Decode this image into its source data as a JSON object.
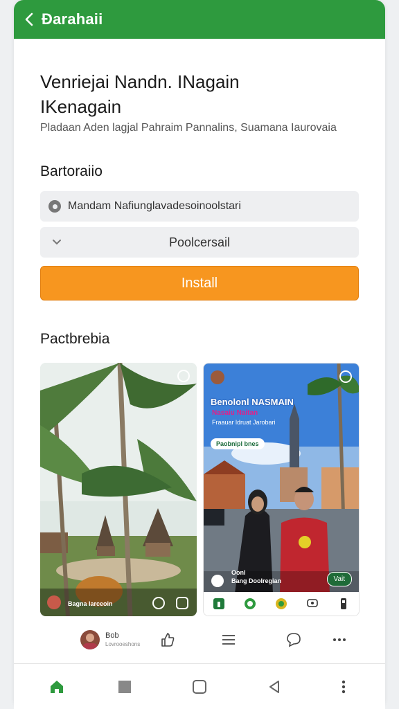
{
  "appbar": {
    "title": "Đarahaii",
    "background": "#2e9a3e"
  },
  "app": {
    "name_line1": "Venriejai Nandn. INagain",
    "name_line2": "IKenagain",
    "subtitle": "Pladaan Aden lagjal Pahraim Pannalins, Suamana Iaurovaia"
  },
  "section_install": {
    "label": "Bartoraiio",
    "url_text": "Mandam Nafiunglavadesoinoolstari",
    "select_value": "Poolcersail",
    "install_label": "Install",
    "install_color": "#f7961f"
  },
  "section_preview": {
    "label": "Pactbrebia",
    "shot1": {
      "caption": "Bagna   Iarceoin",
      "icons": [
        "notification-icon",
        "search-icon",
        "share-icon"
      ]
    },
    "shot2": {
      "poster_title": "Benolonl NASMAIN",
      "poster_sub": "Nasaiu Naitan",
      "poster_sub2": "Fraauar ldruat Jarobari",
      "poster_pill": "Paobnipl bnes",
      "caption_line1": "Oonl",
      "caption_line2": "Bang Doolregian",
      "visit_label": "Vait",
      "bottom_icons": [
        "calendar-icon",
        "globe-icon",
        "badge-icon",
        "chat-icon",
        "phone-icon"
      ]
    }
  },
  "action_row": {
    "user_name": "Bob",
    "user_sub": "Lovrooeshons",
    "icons": [
      "like-icon",
      "menu-icon",
      "comment-icon",
      "more-icon"
    ]
  },
  "navbar": {
    "icons": [
      "home-icon",
      "stop-icon",
      "square-icon",
      "back-triangle-icon",
      "more-vertical-icon"
    ],
    "home_color": "#2e9a3e"
  }
}
